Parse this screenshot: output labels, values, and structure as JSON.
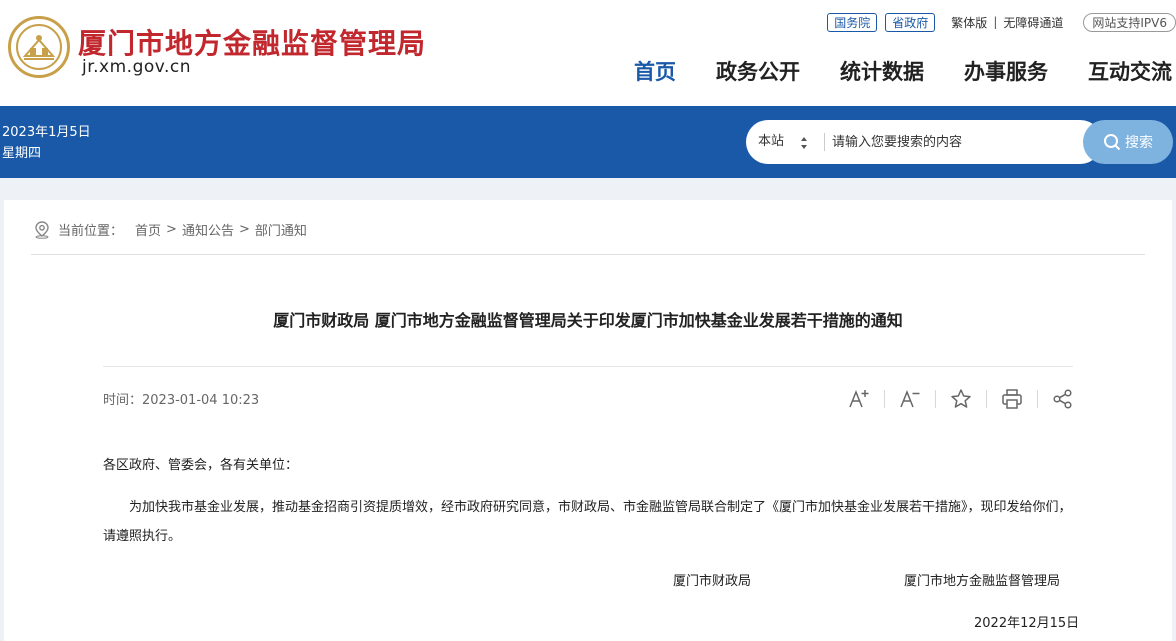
{
  "header": {
    "site_title": "厦门市地方金融监督管理局",
    "domain": "jr.xm.gov.cn",
    "top_links": {
      "guowuyuan": "国务院",
      "shengzhengfu": "省政府",
      "traditional": "繁体版",
      "separator": "|",
      "accessibility": "无障碍通道",
      "ipv6": "网站支持IPV6"
    },
    "nav": [
      "首页",
      "政务公开",
      "统计数据",
      "办事服务",
      "互动交流"
    ]
  },
  "band": {
    "date": "2023年1月5日",
    "weekday": "星期四",
    "search_scope": "本站",
    "search_placeholder": "请输入您要搜索的内容",
    "search_button": "搜索"
  },
  "breadcrumb": {
    "label": "当前位置：",
    "items": [
      "首页",
      "通知公告",
      "部门通知"
    ],
    "separator": ">"
  },
  "article": {
    "title": "厦门市财政局 厦门市地方金融监督管理局关于印发厦门市加快基金业发展若干措施的通知",
    "time_label": "时间：",
    "time_value": "2023-01-04 10:23",
    "salutation": "各区政府、管委会，各有关单位：",
    "paragraph": "为加快我市基金业发展，推动基金招商引资提质增效，经市政府研究同意，市财政局、市金融监管局联合制定了《厦门市加快基金业发展若干措施》，现印发给你们，请遵照执行。",
    "signer1": "厦门市财政局",
    "signer2": "厦门市地方金融监督管理局",
    "sign_date": "2022年12月15日"
  },
  "tools": [
    "font-increase-icon",
    "font-decrease-icon",
    "star-icon",
    "print-icon",
    "share-icon"
  ],
  "colors": {
    "brand_blue": "#1a59a8",
    "title_red": "#c1272d",
    "search_button": "#7eb2df",
    "emblem_gold": "#c8a04a"
  }
}
